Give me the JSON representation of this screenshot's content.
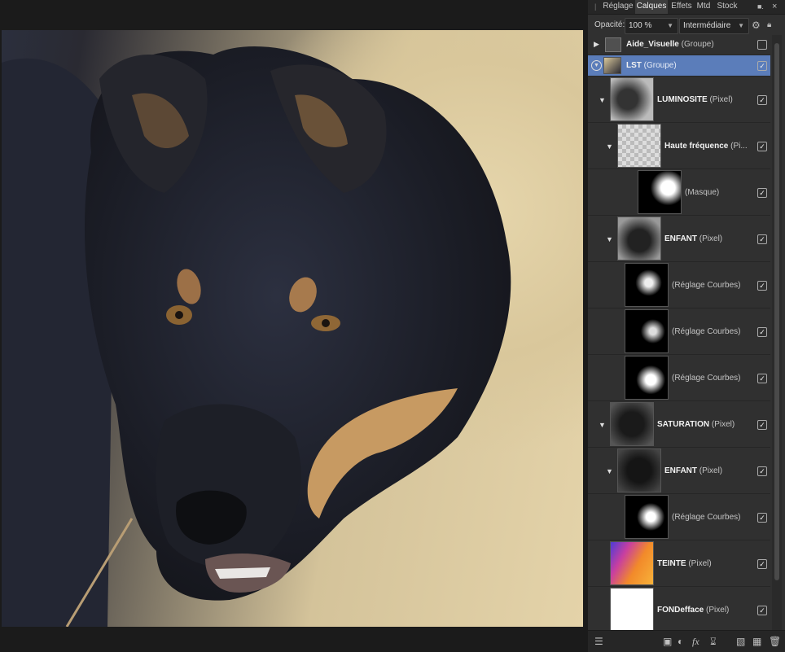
{
  "tabs": [
    {
      "label": "Réglage",
      "active": false
    },
    {
      "label": "Calques",
      "active": true
    },
    {
      "label": "Effets",
      "active": false
    },
    {
      "label": "Mtd",
      "active": false
    },
    {
      "label": "Stock",
      "active": false
    }
  ],
  "opacity": {
    "label": "Opacité:",
    "value": "100 %"
  },
  "blend_mode": {
    "value": "Intermédiaire"
  },
  "layers": [
    {
      "name": "Aide_Visuelle",
      "kind": "(Groupe)",
      "checked": false,
      "selected": false
    },
    {
      "name": "LST",
      "kind": "(Groupe)",
      "checked": true,
      "selected": true
    },
    {
      "name": "LUMINOSITE",
      "kind": "(Pixel)",
      "checked": true
    },
    {
      "name": "Haute fréquence",
      "kind": "(Pi...",
      "checked": true
    },
    {
      "name": "",
      "kind": "(Masque)",
      "checked": true
    },
    {
      "name": "ENFANT",
      "kind": "(Pixel)",
      "checked": true
    },
    {
      "name": "",
      "kind": "(Réglage Courbes)",
      "checked": true
    },
    {
      "name": "",
      "kind": "(Réglage Courbes)",
      "checked": true
    },
    {
      "name": "",
      "kind": "(Réglage Courbes)",
      "checked": true
    },
    {
      "name": "SATURATION",
      "kind": "(Pixel)",
      "checked": true
    },
    {
      "name": "ENFANT",
      "kind": "(Pixel)",
      "checked": true
    },
    {
      "name": "",
      "kind": "(Réglage Courbes)",
      "checked": true
    },
    {
      "name": "TEINTE",
      "kind": "(Pixel)",
      "checked": true
    },
    {
      "name": "FONDefface",
      "kind": "(Pixel)",
      "checked": true
    }
  ],
  "icons": {
    "tab_menu": "menu-icon",
    "lock": "lock-icon",
    "settings": "gear-icon",
    "bottom": [
      "layers-icon",
      "mask-icon",
      "adjustment-icon",
      "fx-icon",
      "live-filter-icon",
      "folder-icon",
      "add-pixel-layer-icon",
      "trash-icon"
    ]
  },
  "colors": {
    "selection": "#5b7dba",
    "panel": "#303030"
  }
}
